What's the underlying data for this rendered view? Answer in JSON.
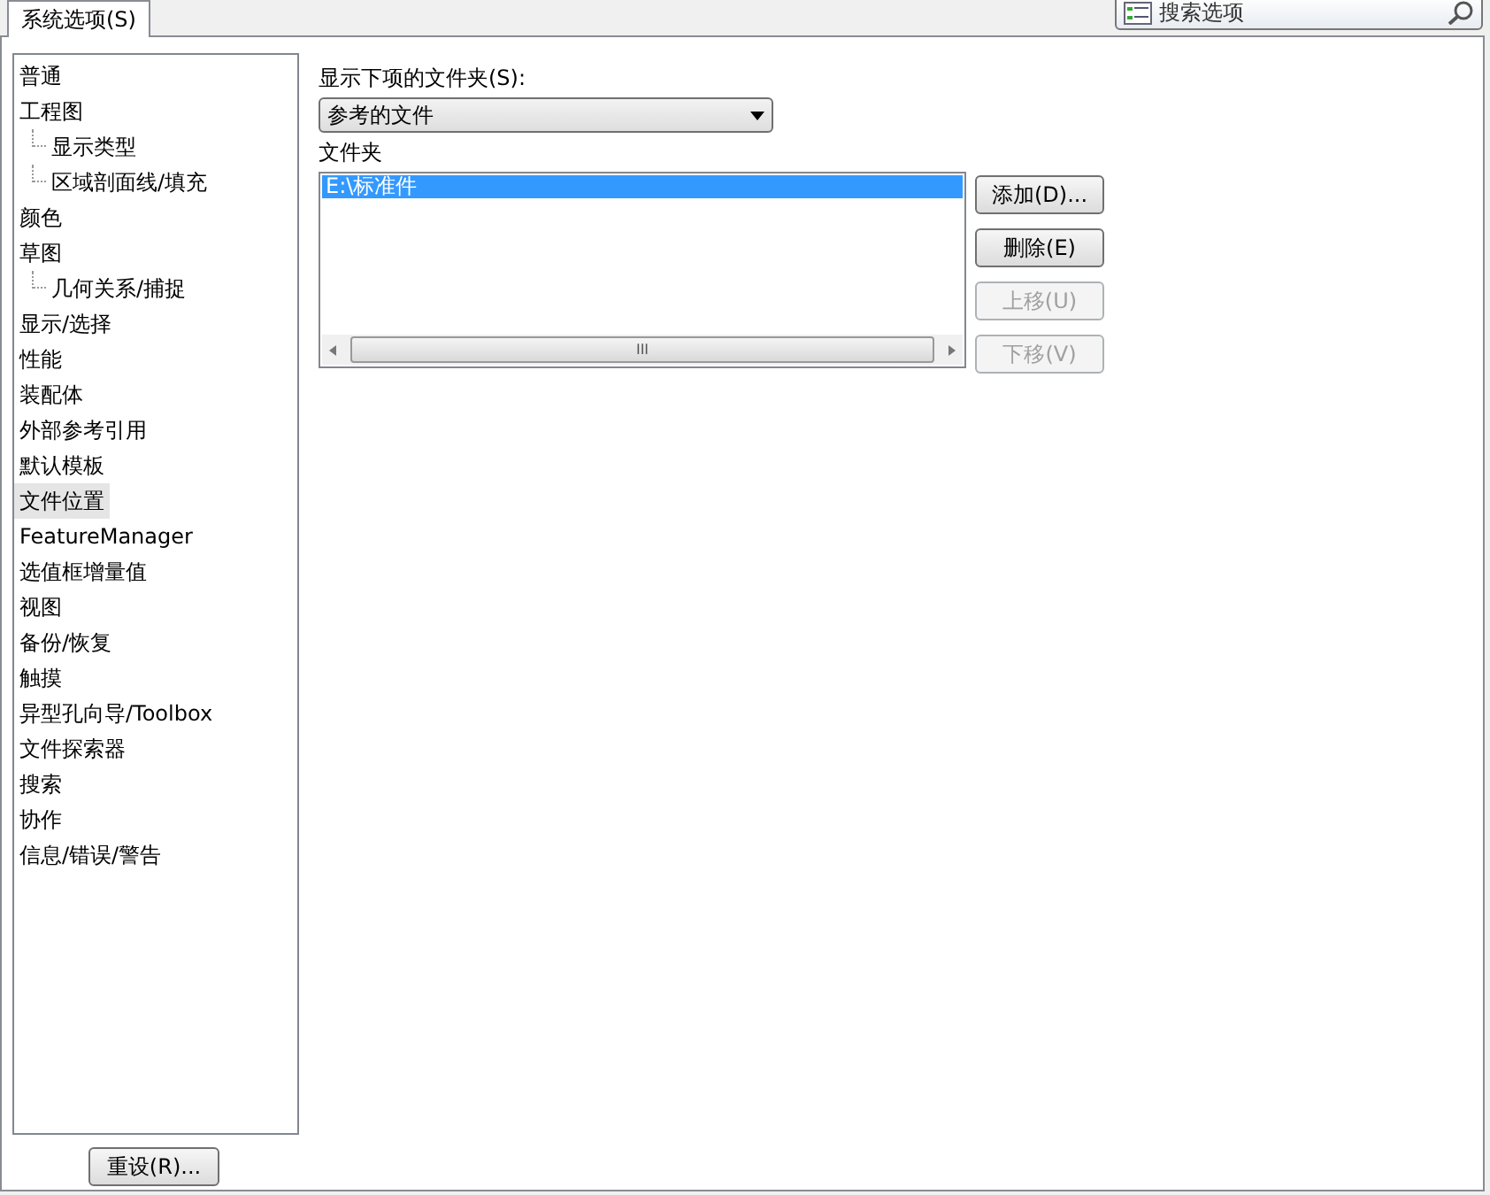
{
  "tabs": [
    {
      "label": "系统选项(S)",
      "selected": true
    }
  ],
  "search": {
    "placeholder": "搜索选项"
  },
  "tree": [
    {
      "label": "普通",
      "selected": false
    },
    {
      "label": "工程图",
      "selected": false,
      "children": [
        {
          "label": "显示类型",
          "selected": false
        },
        {
          "label": "区域剖面线/填充",
          "selected": false
        }
      ]
    },
    {
      "label": "颜色",
      "selected": false
    },
    {
      "label": "草图",
      "selected": false,
      "children": [
        {
          "label": "几何关系/捕捉",
          "selected": false
        }
      ]
    },
    {
      "label": "显示/选择",
      "selected": false
    },
    {
      "label": "性能",
      "selected": false
    },
    {
      "label": "装配体",
      "selected": false
    },
    {
      "label": "外部参考引用",
      "selected": false
    },
    {
      "label": "默认模板",
      "selected": false
    },
    {
      "label": "文件位置",
      "selected": true
    },
    {
      "label": "FeatureManager",
      "selected": false
    },
    {
      "label": "选值框增量值",
      "selected": false
    },
    {
      "label": "视图",
      "selected": false
    },
    {
      "label": "备份/恢复",
      "selected": false
    },
    {
      "label": "触摸",
      "selected": false
    },
    {
      "label": "异型孔向导/Toolbox",
      "selected": false
    },
    {
      "label": "文件探索器",
      "selected": false
    },
    {
      "label": "搜索",
      "selected": false
    },
    {
      "label": "协作",
      "selected": false
    },
    {
      "label": "信息/错误/警告",
      "selected": false
    }
  ],
  "reset_button": "重设(R)...",
  "show_label": "显示下项的文件夹(S):",
  "show_select": "参考的文件",
  "folders_label": "文件夹",
  "folders": [
    {
      "path": "E:\\标准件",
      "selected": true
    }
  ],
  "buttons": [
    {
      "label": "添加(D)...",
      "disabled": false
    },
    {
      "label": "删除(E)",
      "disabled": false
    },
    {
      "label": "上移(U)",
      "disabled": true
    },
    {
      "label": "下移(V)",
      "disabled": true
    }
  ],
  "scroll_thumb": "III"
}
